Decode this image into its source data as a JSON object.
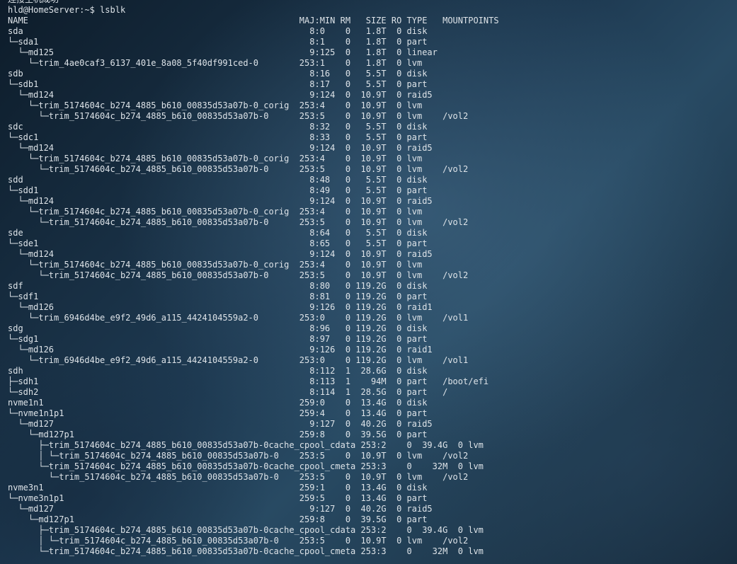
{
  "terminal": {
    "lines": [
      "连接主机成功",
      "hld@HomeServer:~$ lsblk",
      "NAME                                                     MAJ:MIN RM   SIZE RO TYPE   MOUNTPOINTS",
      "sda                                                        8:0    0   1.8T  0 disk",
      "└─sda1                                                     8:1    0   1.8T  0 part",
      "  └─md125                                                  9:125  0   1.8T  0 linear",
      "    └─trim_4ae0caf3_6137_401e_8a08_5f40df991ced-0        253:1    0   1.8T  0 lvm",
      "sdb                                                        8:16   0   5.5T  0 disk",
      "└─sdb1                                                     8:17   0   5.5T  0 part",
      "  └─md124                                                  9:124  0  10.9T  0 raid5",
      "    └─trim_5174604c_b274_4885_b610_00835d53a07b-0_corig  253:4    0  10.9T  0 lvm",
      "      └─trim_5174604c_b274_4885_b610_00835d53a07b-0      253:5    0  10.9T  0 lvm    /vol2",
      "sdc                                                        8:32   0   5.5T  0 disk",
      "└─sdc1                                                     8:33   0   5.5T  0 part",
      "  └─md124                                                  9:124  0  10.9T  0 raid5",
      "    └─trim_5174604c_b274_4885_b610_00835d53a07b-0_corig  253:4    0  10.9T  0 lvm",
      "      └─trim_5174604c_b274_4885_b610_00835d53a07b-0      253:5    0  10.9T  0 lvm    /vol2",
      "sdd                                                        8:48   0   5.5T  0 disk",
      "└─sdd1                                                     8:49   0   5.5T  0 part",
      "  └─md124                                                  9:124  0  10.9T  0 raid5",
      "    └─trim_5174604c_b274_4885_b610_00835d53a07b-0_corig  253:4    0  10.9T  0 lvm",
      "      └─trim_5174604c_b274_4885_b610_00835d53a07b-0      253:5    0  10.9T  0 lvm    /vol2",
      "sde                                                        8:64   0   5.5T  0 disk",
      "└─sde1                                                     8:65   0   5.5T  0 part",
      "  └─md124                                                  9:124  0  10.9T  0 raid5",
      "    └─trim_5174604c_b274_4885_b610_00835d53a07b-0_corig  253:4    0  10.9T  0 lvm",
      "      └─trim_5174604c_b274_4885_b610_00835d53a07b-0      253:5    0  10.9T  0 lvm    /vol2",
      "sdf                                                        8:80   0 119.2G  0 disk",
      "└─sdf1                                                     8:81   0 119.2G  0 part",
      "  └─md126                                                  9:126  0 119.2G  0 raid1",
      "    └─trim_6946d4be_e9f2_49d6_a115_4424104559a2-0        253:0    0 119.2G  0 lvm    /vol1",
      "sdg                                                        8:96   0 119.2G  0 disk",
      "└─sdg1                                                     8:97   0 119.2G  0 part",
      "  └─md126                                                  9:126  0 119.2G  0 raid1",
      "    └─trim_6946d4be_e9f2_49d6_a115_4424104559a2-0        253:0    0 119.2G  0 lvm    /vol1",
      "sdh                                                        8:112  1  28.6G  0 disk",
      "├─sdh1                                                     8:113  1    94M  0 part   /boot/efi",
      "└─sdh2                                                     8:114  1  28.5G  0 part   /",
      "nvme1n1                                                  259:0    0  13.4G  0 disk",
      "└─nvme1n1p1                                              259:4    0  13.4G  0 part",
      "  └─md127                                                  9:127  0  40.2G  0 raid5",
      "    └─md127p1                                            259:8    0  39.5G  0 part",
      "      ├─trim_5174604c_b274_4885_b610_00835d53a07b-0cache_cpool_cdata 253:2    0  39.4G  0 lvm",
      "      │ └─trim_5174604c_b274_4885_b610_00835d53a07b-0    253:5    0  10.9T  0 lvm    /vol2",
      "      └─trim_5174604c_b274_4885_b610_00835d53a07b-0cache_cpool_cmeta 253:3    0    32M  0 lvm",
      "        └─trim_5174604c_b274_4885_b610_00835d53a07b-0    253:5    0  10.9T  0 lvm    /vol2",
      "nvme3n1                                                  259:1    0  13.4G  0 disk",
      "└─nvme3n1p1                                              259:5    0  13.4G  0 part",
      "  └─md127                                                  9:127  0  40.2G  0 raid5",
      "    └─md127p1                                            259:8    0  39.5G  0 part",
      "      ├─trim_5174604c_b274_4885_b610_00835d53a07b-0cache_cpool_cdata 253:2    0  39.4G  0 lvm",
      "      │ └─trim_5174604c_b274_4885_b610_00835d53a07b-0    253:5    0  10.9T  0 lvm    /vol2",
      "      └─trim_5174604c_b274_4885_b610_00835d53a07b-0cache_cpool_cmeta 253:3    0    32M  0 lvm"
    ]
  }
}
